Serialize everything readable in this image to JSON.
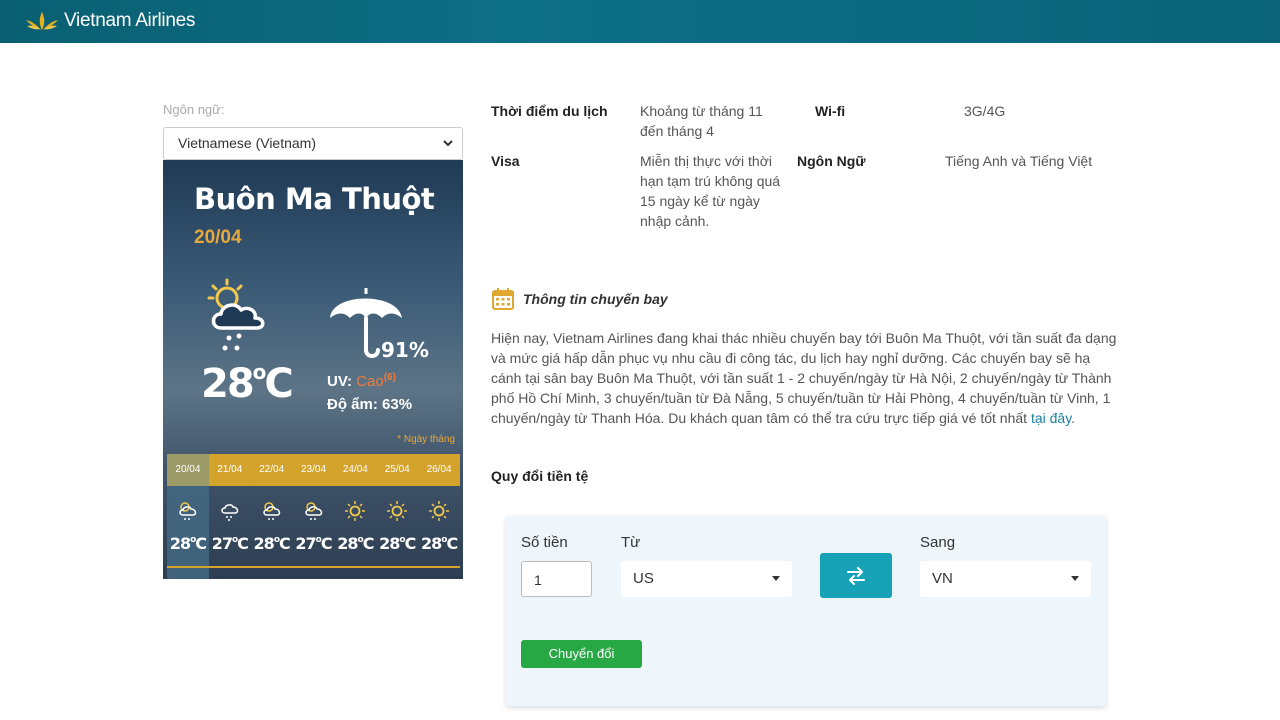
{
  "header": {
    "brand": "Vietnam Airlines"
  },
  "language": {
    "label": "Ngôn ngữ:",
    "selected": "Vietnamese (Vietnam)"
  },
  "weather": {
    "city": "Buôn Ma Thuột",
    "date": "20/04",
    "temp": "28",
    "unit": "C",
    "humidity_pct": "91%",
    "uv_label": "UV:",
    "uv_value": "Cao",
    "uv_index": "(6)",
    "do_am": "Độ ẩm: 63%",
    "note": "* Ngày tháng",
    "days": [
      "20/04",
      "21/04",
      "22/04",
      "23/04",
      "24/04",
      "25/04",
      "26/04"
    ],
    "forecast": [
      {
        "temp": "28",
        "unit": "C",
        "icon": "sun-cloud-rain-icon"
      },
      {
        "temp": "27",
        "unit": "C",
        "icon": "cloud-rain-icon"
      },
      {
        "temp": "28",
        "unit": "C",
        "icon": "sun-cloud-rain-icon"
      },
      {
        "temp": "27",
        "unit": "C",
        "icon": "sun-cloud-rain-icon"
      },
      {
        "temp": "28",
        "unit": "C",
        "icon": "sun-icon"
      },
      {
        "temp": "28",
        "unit": "C",
        "icon": "sun-icon"
      },
      {
        "temp": "28",
        "unit": "C",
        "icon": "sun-icon"
      }
    ]
  },
  "info": {
    "travel_label": "Thời điểm du lịch",
    "travel_value": "Khoảng từ tháng 11 đến tháng 4",
    "wifi_label": "Wi-fi",
    "wifi_value": "3G/4G",
    "visa_label": "Visa",
    "visa_value": "Miễn thị thực với thời hạn tạm trú không quá 15 ngày kể từ ngày nhập cảnh.",
    "lang_label": "Ngôn Ngữ",
    "lang_value": "Tiếng Anh và Tiếng Việt"
  },
  "flight": {
    "title": "Thông tin chuyến bay",
    "text": "Hiện nay, Vietnam Airlines đang khai thác nhiều chuyến bay tới Buôn Ma Thuột, với tần suất đa dạng và mức giá hấp dẫn phục vụ nhu cầu đi công tác, du lịch hay nghỉ dưỡng. Các chuyến bay sẽ hạ cánh tại sân bay Buôn Ma Thuột, với tần suất 1 - 2 chuyến/ngày từ Hà Nội, 2 chuyến/ngày từ Thành phố Hồ Chí Minh, 3 chuyến/tuần từ Đà Nẵng, 5 chuyến/tuần từ Hải Phòng, 4 chuyến/tuần từ Vinh, 1 chuyến/ngày từ Thanh Hóa. Du khách quan tâm có thể tra cứu trực tiếp giá vé tốt nhất ",
    "link": "tại đây",
    "end": "."
  },
  "converter": {
    "title": "Quy đổi tiền tệ",
    "amount_label": "Số tiền",
    "amount_value": "1",
    "from_label": "Từ",
    "from_value": "US",
    "to_label": "Sang",
    "to_value": "VN",
    "button": "Chuyển đổi"
  },
  "colors": {
    "brand_teal": "#0d6f85",
    "accent_gold": "#d4a32c",
    "button_teal": "#17a2b8",
    "button_green": "#28a745"
  }
}
